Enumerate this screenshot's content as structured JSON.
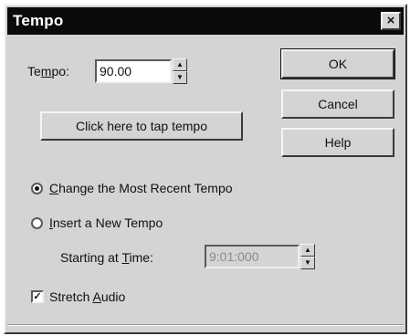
{
  "window": {
    "title": "Tempo",
    "close_glyph": "×"
  },
  "tempo": {
    "label_pre": "Te",
    "label_mnemonic": "m",
    "label_post": "po:",
    "value": "90.00"
  },
  "tap_button": {
    "label": "Click here to tap tempo"
  },
  "buttons": {
    "ok": "OK",
    "cancel": "Cancel",
    "help": "Help"
  },
  "options": {
    "change_recent": {
      "mnemonic": "C",
      "rest": "hange the Most Recent Tempo",
      "selected": true
    },
    "insert_new": {
      "mnemonic": "I",
      "rest": "nsert a New Tempo",
      "selected": false
    }
  },
  "starting_time": {
    "label_pre": "Starting at ",
    "label_mnemonic": "T",
    "label_post": "ime:",
    "value": "9:01:000",
    "disabled": true
  },
  "stretch_audio": {
    "label_pre": "Stretch ",
    "label_mnemonic": "A",
    "label_post": "udio",
    "checked": true
  },
  "icons": {
    "spin_up": "▲",
    "spin_down": "▼",
    "check_mark": "✓"
  }
}
